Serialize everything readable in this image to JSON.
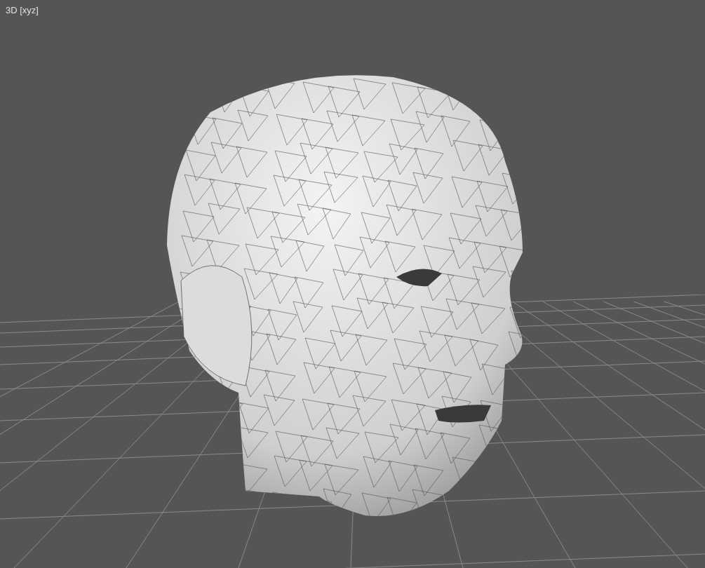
{
  "viewport": {
    "label": "3D [xyz]"
  }
}
